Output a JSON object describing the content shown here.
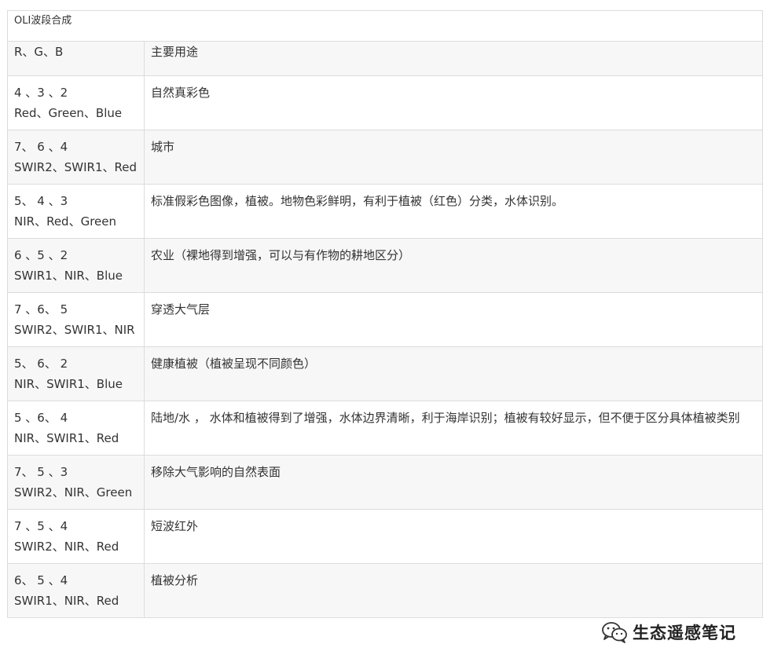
{
  "table": {
    "caption": "OLI波段合成",
    "headers": [
      "R、G、B",
      "主要用途"
    ],
    "rows": [
      {
        "nums": "4 、3 、2",
        "names": "Red、Green、Blue",
        "use": "自然真彩色"
      },
      {
        "nums": "7、 6 、4",
        "names": "SWIR2、SWIR1、Red",
        "use": "城市"
      },
      {
        "nums": "5、 4 、3",
        "names": "NIR、Red、Green",
        "use": "标准假彩色图像，植被。地物色彩鲜明，有利于植被（红色）分类，水体识别。"
      },
      {
        "nums": "6 、5 、2",
        "names": "SWIR1、NIR、Blue",
        "use": "农业（裸地得到增强，可以与有作物的耕地区分）"
      },
      {
        "nums": "7 、6、 5",
        "names": "SWIR2、SWIR1、NIR",
        "use": "穿透大气层"
      },
      {
        "nums": "5、 6、 2",
        "names": "NIR、SWIR1、Blue",
        "use": "健康植被（植被呈现不同颜色）"
      },
      {
        "nums": "5 、6、 4",
        "names": "NIR、SWIR1、Red",
        "use": "陆地/水 ， 水体和植被得到了增强，水体边界清晰，利于海岸识别；植被有较好显示，但不便于区分具体植被类别"
      },
      {
        "nums": "7、 5 、3",
        "names": "SWIR2、NIR、Green",
        "use": "移除大气影响的自然表面"
      },
      {
        "nums": "7 、5 、4",
        "names": "SWIR2、NIR、Red",
        "use": "短波红外"
      },
      {
        "nums": "6、 5 、4",
        "names": "SWIR1、NIR、Red",
        "use": "植被分析"
      }
    ]
  },
  "watermark": {
    "icon": "wechat-icon",
    "text": "生态遥感笔记"
  }
}
